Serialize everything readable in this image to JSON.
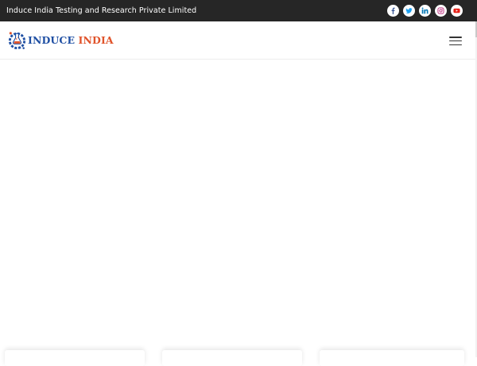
{
  "topbar": {
    "company_name": "Induce India Testing and Research Private Limited",
    "background": "#262626"
  },
  "social_links": [
    {
      "name": "facebook",
      "icon": "facebook-icon"
    },
    {
      "name": "twitter",
      "icon": "twitter-icon"
    },
    {
      "name": "linkedin",
      "icon": "linkedin-icon"
    },
    {
      "name": "instagram",
      "icon": "instagram-icon"
    },
    {
      "name": "youtube",
      "icon": "youtube-icon"
    }
  ],
  "header": {
    "logo": {
      "word1": "INDUCE",
      "word2": "INDIA",
      "color1": "#1f4fa3",
      "color2": "#e0532a"
    },
    "menu_icon": "hamburger-menu-icon"
  },
  "colors": {
    "facebook": "#3b5998",
    "twitter": "#1da1f2",
    "linkedin": "#0077b5",
    "instagram": "#c13584",
    "youtube": "#e62117"
  }
}
